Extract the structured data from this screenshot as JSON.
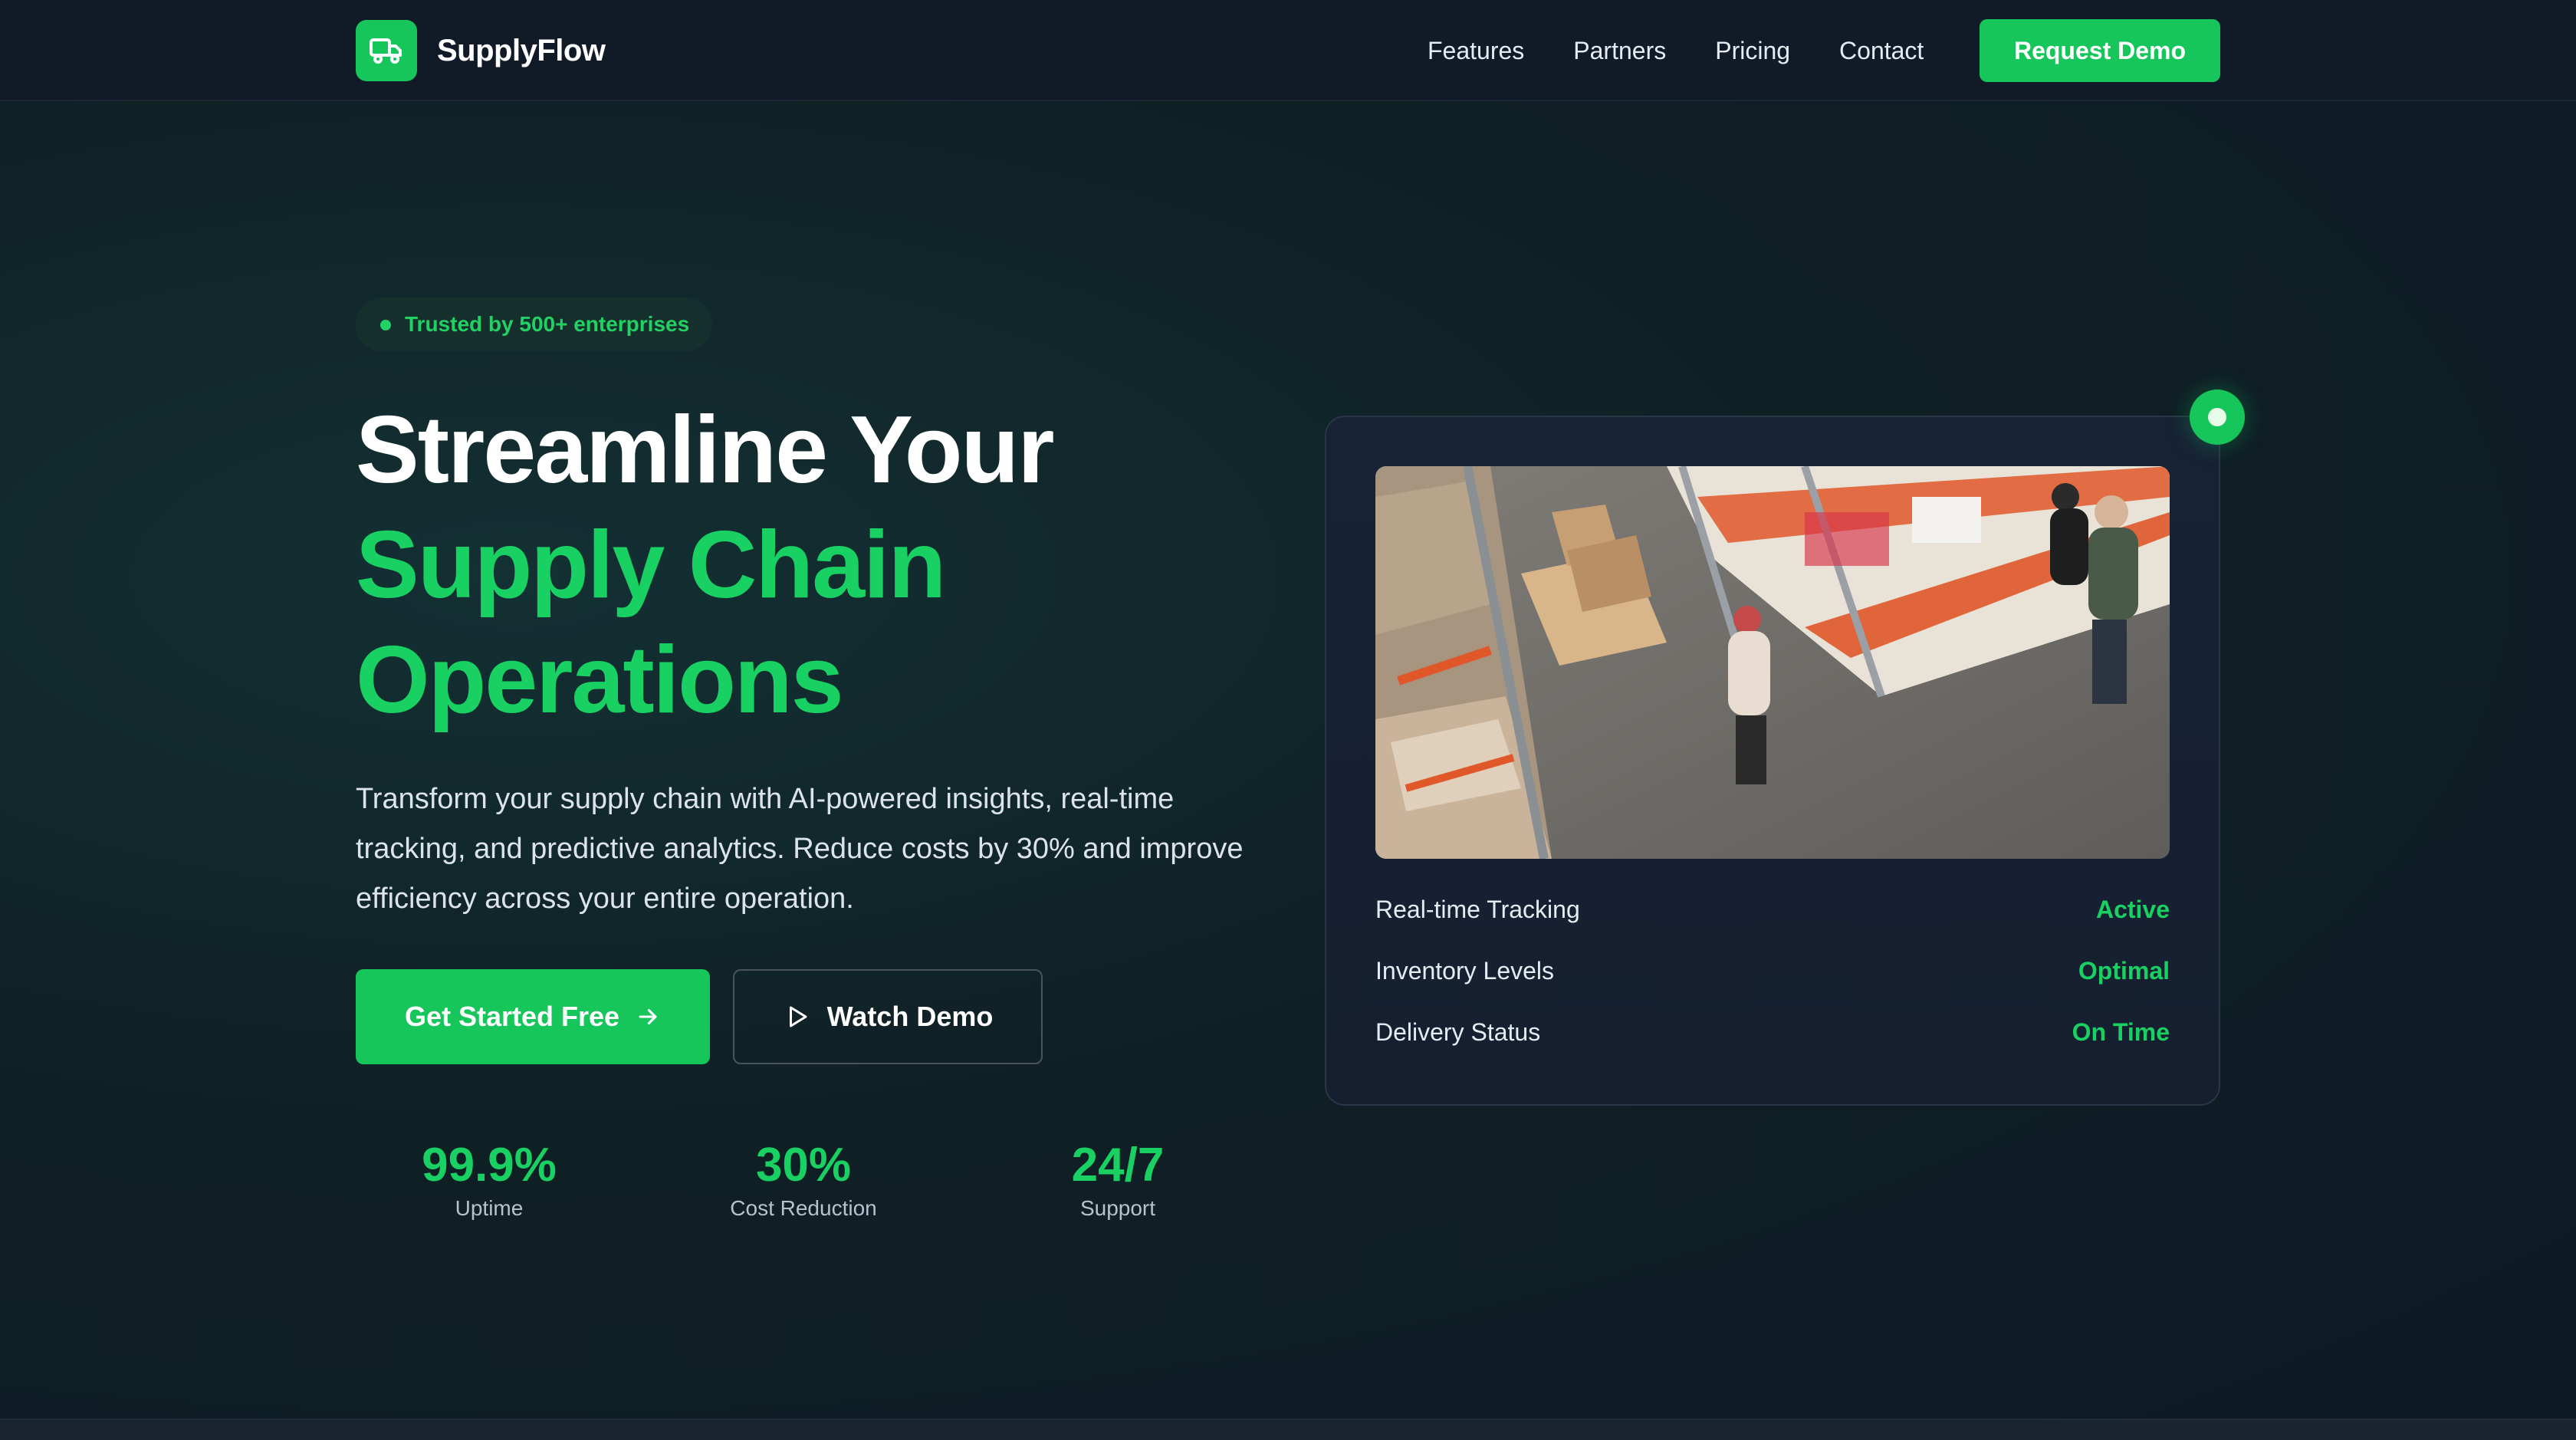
{
  "nav": {
    "brand": "SupplyFlow",
    "logo_icon": "truck-icon",
    "links": [
      "Features",
      "Partners",
      "Pricing",
      "Contact"
    ],
    "cta": "Request Demo"
  },
  "hero": {
    "badge": "Trusted by 500+ enterprises",
    "headline": {
      "line1": "Streamline Your",
      "line2": "Supply Chain",
      "line3": "Operations"
    },
    "description": "Transform your supply chain with AI-powered insights, real-time tracking, and predictive analytics. Reduce costs by 30% and improve efficiency across your entire operation.",
    "primary_button": "Get Started Free",
    "secondary_button": "Watch Demo",
    "stats": [
      {
        "value": "99.9%",
        "label": "Uptime"
      },
      {
        "value": "30%",
        "label": "Cost Reduction"
      },
      {
        "value": "24/7",
        "label": "Support"
      }
    ]
  },
  "card": {
    "status": [
      {
        "label": "Real-time Tracking",
        "value": "Active"
      },
      {
        "label": "Inventory Levels",
        "value": "Optimal"
      },
      {
        "label": "Delivery Status",
        "value": "On Time"
      }
    ]
  },
  "colors": {
    "accent": "#16c65a",
    "accent_text": "#19d162",
    "background": "#0f1a24",
    "nav_background": "#111b28",
    "card_background": "#172235"
  }
}
